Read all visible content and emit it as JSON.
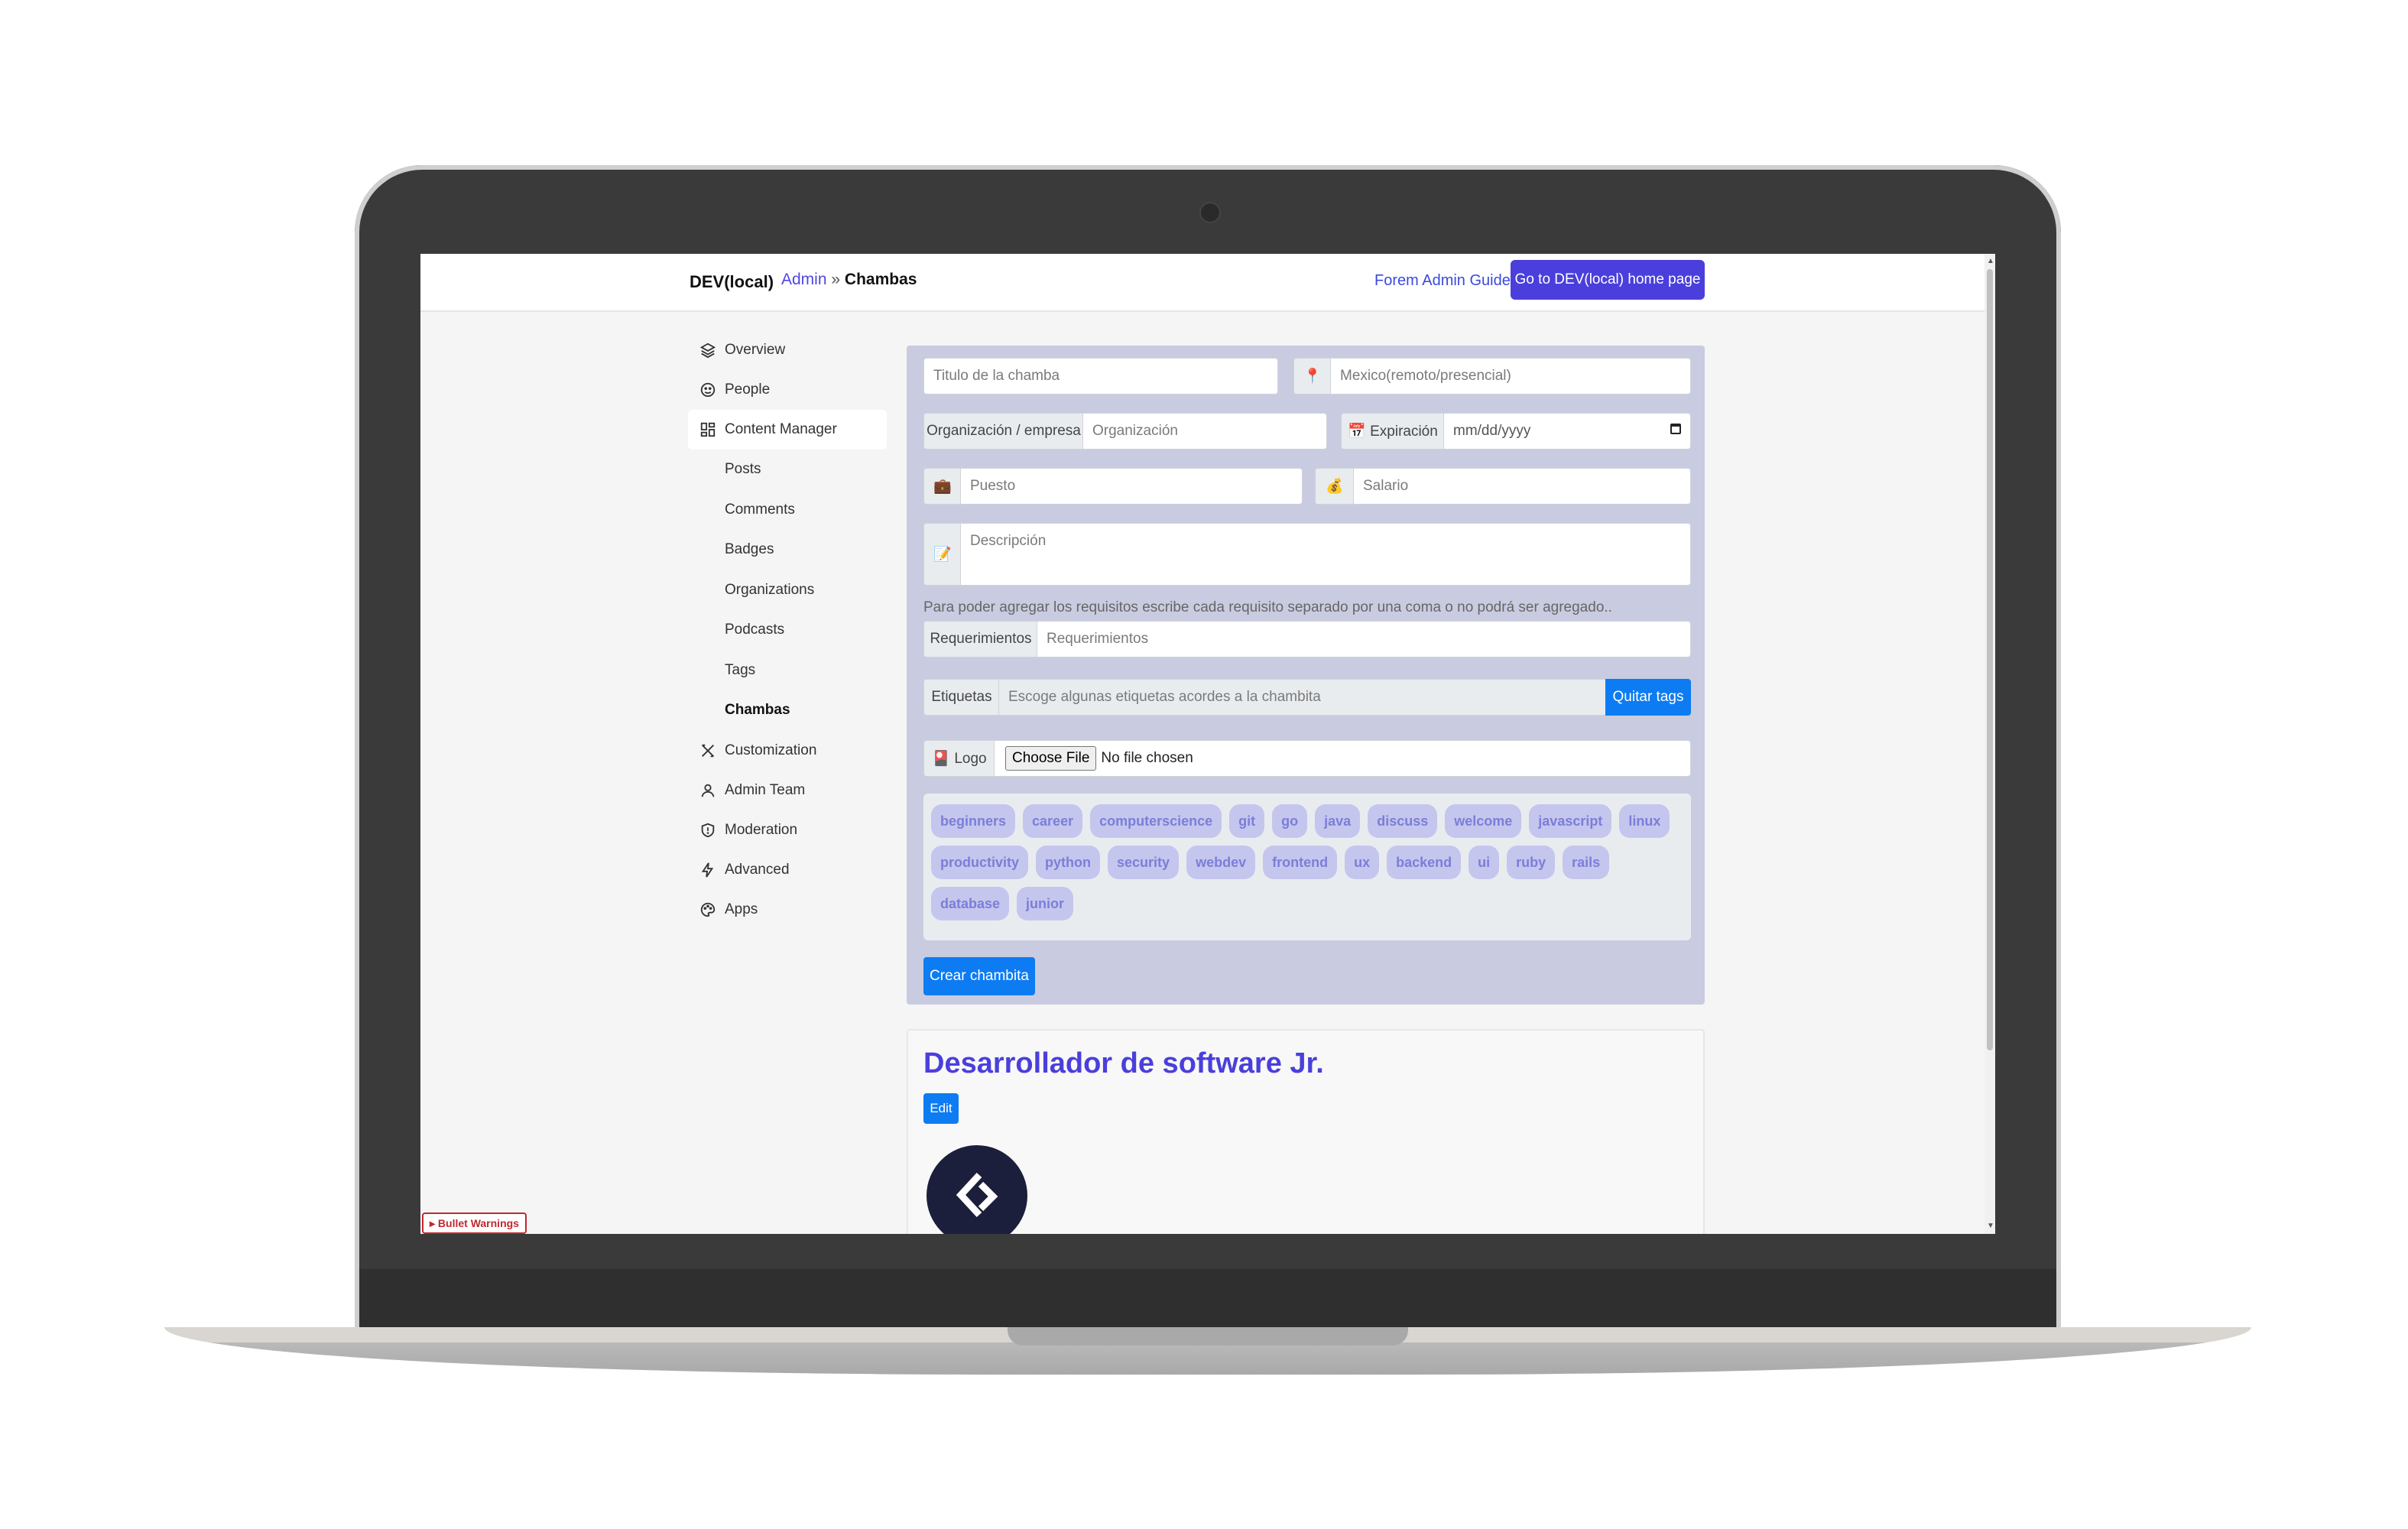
{
  "header": {
    "brand": "DEV(local)",
    "breadcrumb_admin": "Admin",
    "breadcrumb_sep": "»",
    "breadcrumb_current": "Chambas",
    "guide_link": "Forem Admin Guide",
    "home_button": "Go to DEV(local) home page"
  },
  "sidebar": {
    "items": [
      {
        "label": "Overview",
        "icon": "layers-icon"
      },
      {
        "label": "People",
        "icon": "smile-icon"
      },
      {
        "label": "Content Manager",
        "icon": "dashboard-icon"
      }
    ],
    "sub_items": [
      "Posts",
      "Comments",
      "Badges",
      "Organizations",
      "Podcasts",
      "Tags",
      "Chambas"
    ],
    "items_after": [
      {
        "label": "Customization",
        "icon": "tools-icon"
      },
      {
        "label": "Admin Team",
        "icon": "user-icon"
      },
      {
        "label": "Moderation",
        "icon": "shield-icon"
      },
      {
        "label": "Advanced",
        "icon": "bolt-icon"
      },
      {
        "label": "Apps",
        "icon": "palette-icon"
      }
    ]
  },
  "form": {
    "title_placeholder": "Titulo de la chamba",
    "location_icon": "📍",
    "location_placeholder": "Mexico(remoto/presencial)",
    "org_label": "Organización / empresa",
    "org_placeholder": "Organización",
    "expiration_label": "📅 Expiración",
    "expiration_placeholder": "mm/dd/yyyy",
    "position_icon": "💼",
    "position_placeholder": "Puesto",
    "salary_icon": "💰",
    "salary_placeholder": "Salario",
    "description_icon": "📝",
    "description_placeholder": "Descripción",
    "requirements_hint": "Para poder agregar los requisitos escribe cada requisito separado por una coma o no podrá ser agregado..",
    "requirements_label": "Requerimientos",
    "requirements_placeholder": "Requerimientos",
    "tags_label": "Etiquetas",
    "tags_placeholder": "Escoge algunas etiquetas acordes a la chambita",
    "remove_tags_button": "Quitar tags",
    "logo_label": "🎴 Logo",
    "file_button": "Choose File",
    "file_status": "No file chosen",
    "tags": [
      "beginners",
      "career",
      "computerscience",
      "git",
      "go",
      "java",
      "discuss",
      "welcome",
      "javascript",
      "linux",
      "productivity",
      "python",
      "security",
      "webdev",
      "frontend",
      "ux",
      "backend",
      "ui",
      "ruby",
      "rails",
      "database",
      "junior"
    ],
    "create_button": "Crear chambita"
  },
  "job": {
    "title": "Desarrollador de software Jr.",
    "edit_button": "Edit"
  },
  "debug": {
    "bullet_warnings": "▸ Bullet Warnings"
  },
  "colors": {
    "accent": "#4a3fdc",
    "primary_button": "#0d7cf2",
    "panel_bg": "#c9cce0",
    "tag_bg": "#c4c6ee",
    "tag_text": "#7b7ed8"
  }
}
